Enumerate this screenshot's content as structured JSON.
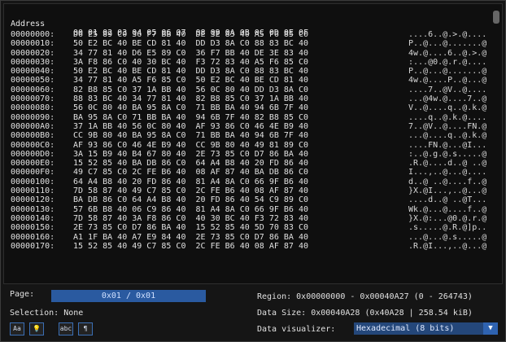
{
  "header": {
    "address_label": "Address",
    "columns": "00 01 02 03 04 05 06 07  08 09 0A 0B 0C 0D 0E 0F"
  },
  "rows": [
    {
      "addr": "00000000:",
      "hex": "D6 E5 89 C0 36 F7 BB 40  DE 3E 83 40 A5 F6 85 C0",
      "text": "....6..@.>.@...."
    },
    {
      "addr": "00000010:",
      "hex": "50 E2 BC 40 BE CD 81 40  DD D3 8A C0 88 83 BC 40",
      "text": "P..@...@.......@"
    },
    {
      "addr": "00000020:",
      "hex": "34 77 81 40 D6 E5 89 C0  36 F7 BB 40 DE 3E 83 40",
      "text": "4w.@....6..@.>.@"
    },
    {
      "addr": "00000030:",
      "hex": "3A F8 86 C0 40 30 BC 40  F3 72 83 40 A5 F6 85 C0",
      "text": ":...@0.@.r.@...."
    },
    {
      "addr": "00000040:",
      "hex": "50 E2 BC 40 BE CD 81 40  DD D3 8A C0 88 83 BC 40",
      "text": "P..@...@.......@"
    },
    {
      "addr": "00000050:",
      "hex": "34 77 81 40 A5 F6 85 C0  50 E2 BC 40 BE CD 81 40",
      "text": "4w.@....P..@...@"
    },
    {
      "addr": "00000060:",
      "hex": "82 B8 85 C0 37 1A BB 40  56 0C 80 40 DD D3 8A C0",
      "text": "....7..@V..@...."
    },
    {
      "addr": "00000070:",
      "hex": "88 83 BC 40 34 77 81 40  82 B8 85 C0 37 1A BB 40",
      "text": "...@4w.@....7..@"
    },
    {
      "addr": "00000080:",
      "hex": "56 0C 80 40 BA 95 8A C0  71 BB BA 40 94 6B 7F 40",
      "text": "V..@....q..@.k.@"
    },
    {
      "addr": "00000090:",
      "hex": "BA 95 8A C0 71 BB BA 40  94 6B 7F 40 82 B8 85 C0",
      "text": "....q..@.k.@...."
    },
    {
      "addr": "000000A0:",
      "hex": "37 1A BB 40 56 0C 80 40  AF 93 86 C0 46 4E B9 40",
      "text": "7..@V..@....FN.@"
    },
    {
      "addr": "000000B0:",
      "hex": "CC 9B 80 40 BA 95 8A C0  71 BB BA 40 94 6B 7F 40",
      "text": "...@....q..@.k.@"
    },
    {
      "addr": "000000C0:",
      "hex": "AF 93 86 C0 46 4E B9 40  CC 9B 80 40 49 81 89 C0",
      "text": "....FN.@...@I..."
    },
    {
      "addr": "000000D0:",
      "hex": "3A 15 B9 40 B4 67 80 40  2E 73 85 C0 D7 86 BA 40",
      "text": ":..@.g.@.s.....@"
    },
    {
      "addr": "000000E0:",
      "hex": "15 52 85 40 BA DB 86 C0  64 A4 B8 40 20 FD 86 40",
      "text": ".R.@....d..@ ..@"
    },
    {
      "addr": "000000F0:",
      "hex": "49 C7 85 C0 2C FE B6 40  08 AF 87 40 BA DB 86 C0",
      "text": "I...,..@...@...."
    },
    {
      "addr": "00000100:",
      "hex": "64 A4 B8 40 20 FD 86 40  81 A4 8A C0 66 9F B6 40",
      "text": "d..@ ..@....f..@"
    },
    {
      "addr": "00000110:",
      "hex": "7D 58 87 40 49 C7 85 C0  2C FE B6 40 08 AF 87 40",
      "text": "}X.@I...,..@...@"
    },
    {
      "addr": "00000120:",
      "hex": "BA DB 86 C0 64 A4 B8 40  20 FD 86 40 54 C9 89 C0",
      "text": "....d..@ ..@T..."
    },
    {
      "addr": "00000130:",
      "hex": "57 6B B8 40 06 C9 86 40  81 A4 8A C0 66 9F B6 40",
      "text": "Wk.@...@....f..@"
    },
    {
      "addr": "00000140:",
      "hex": "7D 58 87 40 3A F8 86 C0  40 30 BC 40 F3 72 83 40",
      "text": "}X.@:...@0.@.r.@"
    },
    {
      "addr": "00000150:",
      "hex": "2E 73 85 C0 D7 86 BA 40  15 52 85 40 5D 70 83 C0",
      "text": ".s.....@.R.@]p.."
    },
    {
      "addr": "00000160:",
      "hex": "A1 1F BA 40 A7 E9 84 40  2E 73 85 C0 D7 86 BA 40",
      "text": "...@...@.s.....@"
    },
    {
      "addr": "00000170:",
      "hex": "15 52 85 40 49 C7 85 C0  2C FE B6 40 08 AF 87 40",
      "text": ".R.@I...,..@...@"
    }
  ],
  "footer": {
    "page_label": "Page:",
    "page_value": "0x01 / 0x01",
    "region": "Region: 0x00000000 - 0x00040A27 (0 - 264743)",
    "selection": "Selection: None",
    "data_size": "Data Size: 0x00040A28 (0x40A28 | 258.54 kiB)",
    "visualizer_label": "Data visualizer:",
    "visualizer_value": "Hexadecimal (8 bits)"
  },
  "toolbar": [
    {
      "name": "case-toggle-icon",
      "glyph": "Aa"
    },
    {
      "name": "lightbulb-icon",
      "glyph": "💡"
    },
    {
      "name": "ascii-toggle-icon",
      "glyph": "abc"
    },
    {
      "name": "pilcrow-icon",
      "glyph": "¶"
    }
  ]
}
